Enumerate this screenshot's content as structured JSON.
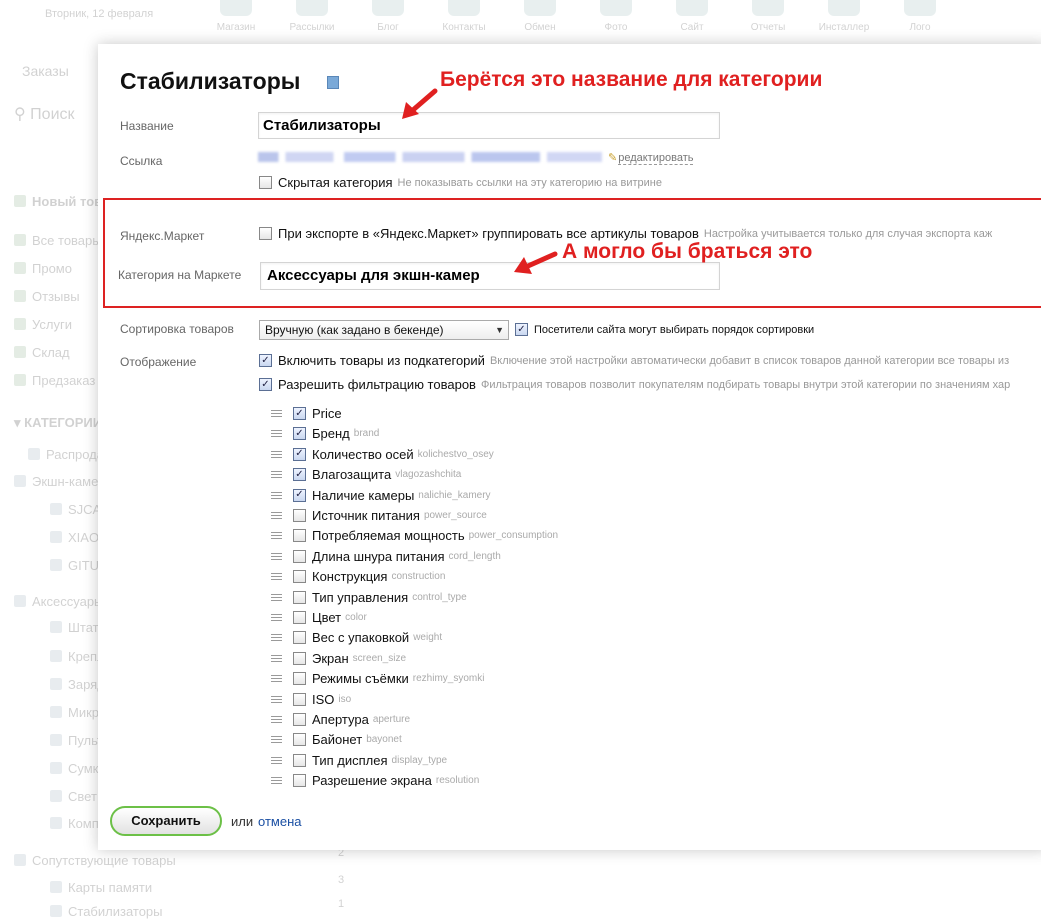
{
  "background": {
    "date": "Вторник, 12 февраля",
    "top_icons": [
      "Магазин",
      "Рассылки",
      "Блог",
      "Контакты",
      "Обмен",
      "Фото",
      "Сайт",
      "Отчеты",
      "Инсталлер",
      "Лого"
    ],
    "orders": "Заказы",
    "search": "Поиск",
    "new_item": "Новый товар",
    "sidebar": [
      "Все товары",
      "Промо",
      "Отзывы",
      "Услуги",
      "Склад",
      "Предзаказ"
    ],
    "categories_header": "КАТЕГОРИИ",
    "tree": [
      "Распродажа",
      "Экшн-камеры",
      "SJCAM",
      "XIAOMI",
      "GITUP",
      "Аксессуары",
      "Штативы",
      "Крепления",
      "Зарядные",
      "Микрофоны",
      "Пульты",
      "Сумки",
      "Свет",
      "Комплекты",
      "Сопутствующие товары",
      "Карты памяти",
      "Стабилизаторы"
    ],
    "counts": [
      "2",
      "3",
      "1"
    ]
  },
  "dialog": {
    "title": "Стабилизаторы",
    "name_label": "Название",
    "name_value": "Стабилизаторы",
    "link_label": "Ссылка",
    "edit_link": "редактировать",
    "hidden_label": "Скрытая категория",
    "hidden_hint": "Не показывать ссылки на эту категорию на витрине",
    "yandex_label": "Яндекс.Маркет",
    "yandex_group_label": "При экспорте в «Яндекс.Маркет» группировать все артикулы товаров",
    "yandex_group_hint": "Настройка учитывается только для случая экспорта каж",
    "market_category_label": "Категория на Маркете",
    "market_category_value": "Аксессуары для экшн-камер",
    "sort_label": "Сортировка товаров",
    "sort_value": "Вручную (как задано в бекенде)",
    "visitors_sort_label": "Посетители сайта могут выбирать порядок сортировки",
    "display_label": "Отображение",
    "include_sub_label": "Включить товары из подкатегорий",
    "include_sub_hint": "Включение этой настройки автоматически добавит в список товаров данной категории все товары из",
    "allow_filter_label": "Разрешить фильтрацию товаров",
    "allow_filter_hint": "Фильтрация товаров позволит покупателям подбирать товары внутри этой категории по значениям хар",
    "properties": [
      {
        "name": "Price",
        "code": "",
        "checked": true
      },
      {
        "name": "Бренд",
        "code": "brand",
        "checked": true
      },
      {
        "name": "Количество осей",
        "code": "kolichestvo_osey",
        "checked": true
      },
      {
        "name": "Влагозащита",
        "code": "vlagozashchita",
        "checked": true
      },
      {
        "name": "Наличие камеры",
        "code": "nalichie_kamery",
        "checked": true
      },
      {
        "name": "Источник питания",
        "code": "power_source",
        "checked": false
      },
      {
        "name": "Потребляемая мощность",
        "code": "power_consumption",
        "checked": false
      },
      {
        "name": "Длина шнура питания",
        "code": "cord_length",
        "checked": false
      },
      {
        "name": "Конструкция",
        "code": "construction",
        "checked": false
      },
      {
        "name": "Тип управления",
        "code": "control_type",
        "checked": false
      },
      {
        "name": "Цвет",
        "code": "color",
        "checked": false
      },
      {
        "name": "Вес с упаковкой",
        "code": "weight",
        "checked": false
      },
      {
        "name": "Экран",
        "code": "screen_size",
        "checked": false
      },
      {
        "name": "Режимы съёмки",
        "code": "rezhimy_syomki",
        "checked": false
      },
      {
        "name": "ISO",
        "code": "iso",
        "checked": false
      },
      {
        "name": "Апертура",
        "code": "aperture",
        "checked": false
      },
      {
        "name": "Байонет",
        "code": "bayonet",
        "checked": false
      },
      {
        "name": "Тип дисплея",
        "code": "display_type",
        "checked": false
      },
      {
        "name": "Разрешение экрана",
        "code": "resolution",
        "checked": false
      }
    ],
    "save_label": "Сохранить",
    "or_text": "или",
    "cancel_label": "отмена"
  },
  "annotations": {
    "top": "Берётся это название для категории",
    "middle": "А могло бы браться это"
  },
  "colors": {
    "annotation_red": "#e02020",
    "save_border": "#6cc047",
    "link_blue": "#1a4fa3"
  }
}
